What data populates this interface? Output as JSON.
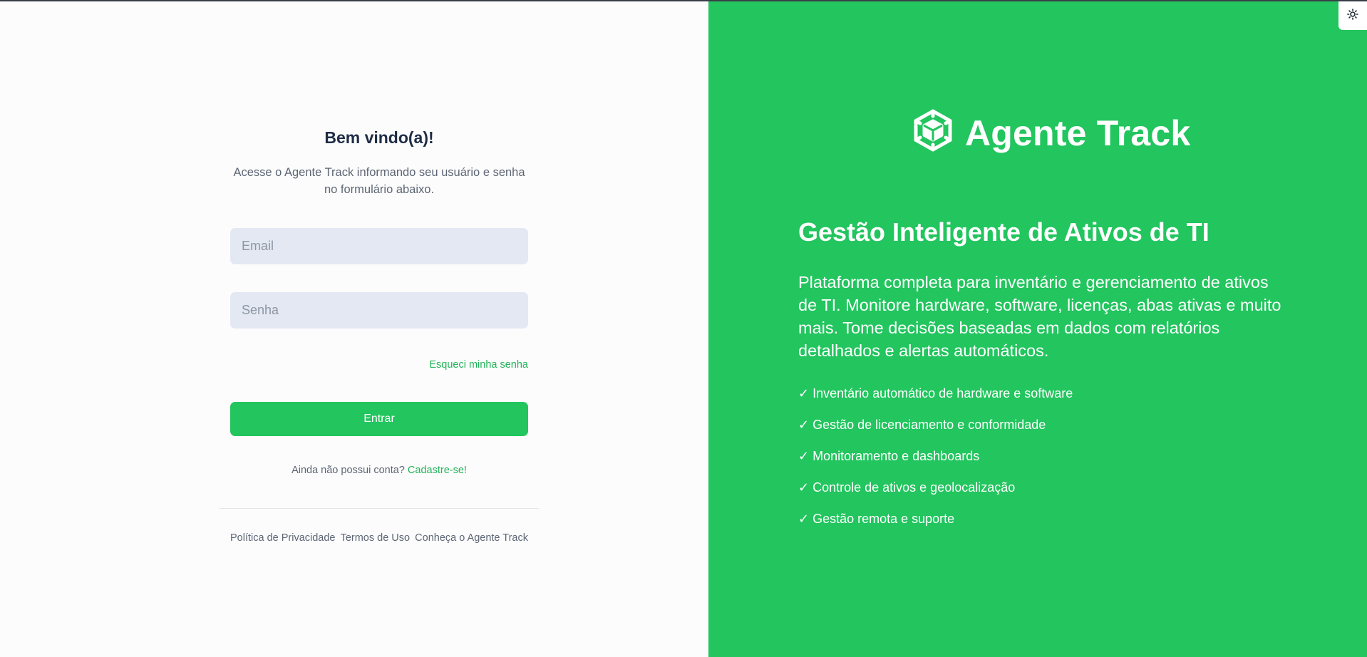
{
  "login": {
    "title": "Bem vindo(a)!",
    "subtitle": "Acesse o Agente Track informando seu usuário e senha no formulário abaixo.",
    "email_placeholder": "Email",
    "password_placeholder": "Senha",
    "forgot_password": "Esqueci minha senha",
    "submit_label": "Entrar",
    "no_account_text": "Ainda não possui conta?",
    "signup_link": "Cadastre-se!"
  },
  "footer": {
    "links": [
      "Política de Privacidade",
      "Termos de Uso",
      "Conheça o Agente Track"
    ]
  },
  "hero": {
    "brand_name": "Agente Track",
    "headline": "Gestão Inteligente de Ativos de TI",
    "description": "Plataforma completa para inventário e gerenciamento de ativos de TI. Monitore hardware, software, licenças, abas ativas e muito mais. Tome decisões baseadas em dados com relatórios detalhados e alertas automáticos.",
    "features": [
      "✓ Inventário automático de hardware e software",
      "✓ Gestão de licenciamento e conformidade",
      "✓ Monitoramento e dashboards",
      "✓ Controle de ativos e geolocalização",
      "✓ Gestão remota e suporte"
    ]
  },
  "icons": {
    "brand_logo": "cube-logo-icon",
    "theme_toggle": "sun-icon"
  },
  "colors": {
    "accent": "#22c55e",
    "title_text": "#1f2d47",
    "muted_text": "#5d6675",
    "input_bg": "#e3e8f2"
  }
}
